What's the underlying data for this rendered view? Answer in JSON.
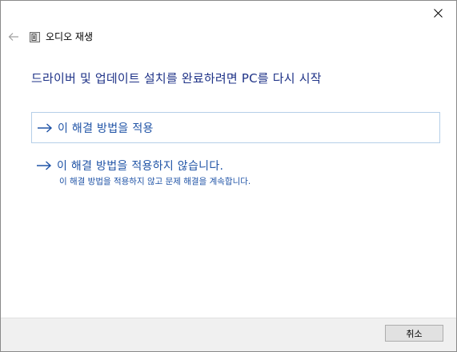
{
  "window": {
    "title": "오디오 재생"
  },
  "heading": "드라이버 및 업데이트 설치를 완료하려면 PC를 다시 시작",
  "options": [
    {
      "label": "이 해결 방법을 적용"
    },
    {
      "label": "이 해결 방법을 적용하지 않습니다.",
      "sublabel": "이 해결 방법을 적용하지 않고 문제 해결을 계속합니다."
    }
  ],
  "footer": {
    "cancel_label": "취소"
  },
  "colors": {
    "link": "#1f53a6",
    "heading": "#1e3287",
    "option_border": "#b5cfe8",
    "footer_bg": "#f0f0f0"
  },
  "icons": {
    "close": "close-icon",
    "back": "back-arrow-icon",
    "app": "troubleshooter-icon",
    "option": "right-arrow-icon"
  }
}
